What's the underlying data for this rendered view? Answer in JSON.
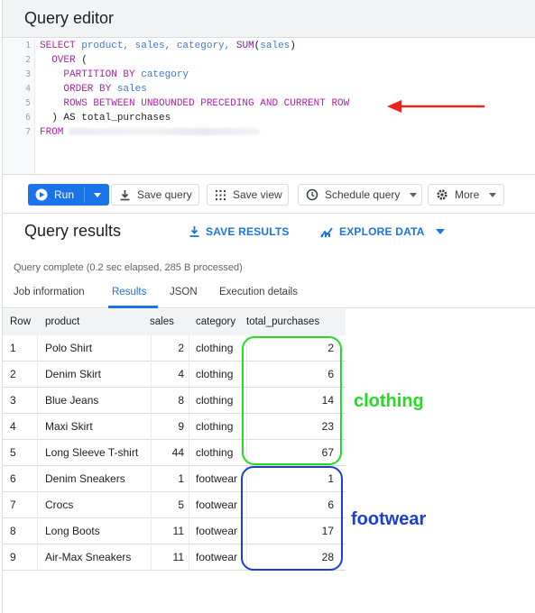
{
  "header": {
    "title": "Query editor"
  },
  "editor": {
    "line_numbers": [
      "1",
      "2",
      "3",
      "4",
      "5",
      "6",
      "7"
    ],
    "lines": [
      [
        {
          "t": "SELECT ",
          "c": "kw"
        },
        {
          "t": "product, sales, category, ",
          "c": "id"
        },
        {
          "t": "SUM",
          "c": "fn"
        },
        {
          "t": "(",
          "c": "pl"
        },
        {
          "t": "sales",
          "c": "id"
        },
        {
          "t": ")",
          "c": "pl"
        }
      ],
      [
        {
          "t": "  OVER ",
          "c": "kw"
        },
        {
          "t": "(",
          "c": "pl"
        }
      ],
      [
        {
          "t": "    PARTITION BY ",
          "c": "kw"
        },
        {
          "t": "category",
          "c": "id"
        }
      ],
      [
        {
          "t": "    ORDER BY ",
          "c": "kw"
        },
        {
          "t": "sales",
          "c": "id"
        }
      ],
      [
        {
          "t": "    ROWS BETWEEN UNBOUNDED PRECEDING AND CURRENT ROW",
          "c": "kw"
        }
      ],
      [
        {
          "t": "  ) AS ",
          "c": "pl"
        },
        {
          "t": "total_purchases",
          "c": "pl"
        }
      ],
      [
        {
          "t": "FROM",
          "c": "kw"
        },
        {
          "t": "",
          "c": "blur"
        }
      ]
    ]
  },
  "toolbar": {
    "run_label": "Run",
    "save_query_label": "Save query",
    "save_view_label": "Save view",
    "schedule_query_label": "Schedule query",
    "more_label": "More"
  },
  "results": {
    "title": "Query results",
    "save_results_label": "SAVE RESULTS",
    "explore_data_label": "EXPLORE DATA",
    "status": "Query complete (0.2 sec elapsed, 285 B processed)",
    "tabs": [
      "Job information",
      "Results",
      "JSON",
      "Execution details"
    ],
    "active_tab": "Results"
  },
  "table": {
    "columns": [
      "Row",
      "product",
      "sales",
      "category",
      "total_purchases"
    ],
    "rows": [
      [
        "1",
        "Polo Shirt",
        "2",
        "clothing",
        "2"
      ],
      [
        "2",
        "Denim Skirt",
        "4",
        "clothing",
        "6"
      ],
      [
        "3",
        "Blue Jeans",
        "8",
        "clothing",
        "14"
      ],
      [
        "4",
        "Maxi Skirt",
        "9",
        "clothing",
        "23"
      ],
      [
        "5",
        "Long Sleeve T-shirt",
        "44",
        "clothing",
        "67"
      ],
      [
        "6",
        "Denim Sneakers",
        "1",
        "footwear",
        "1"
      ],
      [
        "7",
        "Crocs",
        "5",
        "footwear",
        "6"
      ],
      [
        "8",
        "Long Boots",
        "11",
        "footwear",
        "17"
      ],
      [
        "9",
        "Air-Max Sneakers",
        "11",
        "footwear",
        "28"
      ]
    ]
  },
  "annotations": {
    "clothing_label": "clothing",
    "footwear_label": "footwear",
    "clothing_color": "#22dd22",
    "footwear_color": "#1a3fd6",
    "arrow_color": "#e8281e"
  },
  "colors": {
    "accent": "#1a73e8",
    "keyword": "#a626a4",
    "identifier": "#3c78d8"
  },
  "icons": {
    "run": "play-icon",
    "save_query": "save-icon",
    "save_view": "grid-icon",
    "schedule_query": "clock-icon",
    "more": "gear-icon",
    "save_results": "download-icon",
    "explore_data": "chart-icon"
  }
}
